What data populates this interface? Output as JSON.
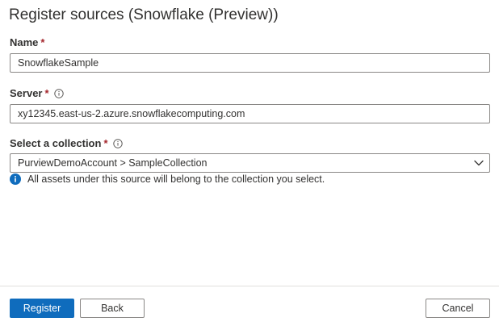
{
  "dialog": {
    "title": "Register sources (Snowflake (Preview))"
  },
  "form": {
    "name": {
      "label": "Name",
      "required_mark": "*",
      "value": "SnowflakeSample"
    },
    "server": {
      "label": "Server",
      "required_mark": "*",
      "value": "xy12345.east-us-2.azure.snowflakecomputing.com",
      "icon": "info-icon"
    },
    "collection": {
      "label": "Select a collection",
      "required_mark": "*",
      "value": "PurviewDemoAccount > SampleCollection",
      "icon": "info-icon",
      "dropdown_icon": "chevron-down-icon"
    },
    "collection_hint": "All assets under this source will belong to the collection you select."
  },
  "footer": {
    "register_label": "Register",
    "back_label": "Back",
    "cancel_label": "Cancel"
  },
  "colors": {
    "primary": "#0f6cbd",
    "required": "#a4262c",
    "text": "#323130",
    "border": "#8a8886"
  }
}
